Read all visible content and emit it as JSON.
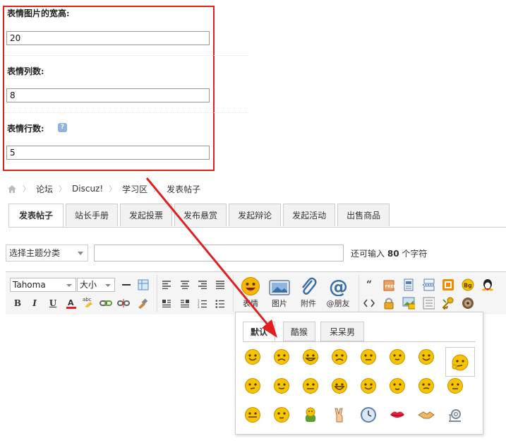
{
  "settings": {
    "width_label": "表情图片的宽高:",
    "width_value": "20",
    "cols_label": "表情列数:",
    "cols_value": "8",
    "rows_label": "表情行数:",
    "rows_value": "5",
    "highlight_color": "#e02020"
  },
  "breadcrumb": [
    "论坛",
    "Discuz!",
    "学习区",
    "发表帖子"
  ],
  "tabs": [
    "发表帖子",
    "站长手册",
    "发起投票",
    "发布悬赏",
    "发起辩论",
    "发起活动",
    "出售商品"
  ],
  "active_tab": "发表帖子",
  "subject": {
    "category_select": "选择主题分类",
    "char_hint_prefix": "还可输入",
    "char_count": "80",
    "char_hint_suffix": "个字符"
  },
  "editor": {
    "font_family": "Tahoma",
    "font_size": "大小",
    "format_buttons": [
      "B",
      "I",
      "U"
    ],
    "big_buttons": [
      "表情",
      "图片",
      "附件",
      "@朋友"
    ]
  },
  "emoji_popup": {
    "tabs": [
      "默认",
      "酷猴",
      "呆呆男"
    ],
    "active_tab": "默认",
    "columns": 8,
    "rows_visible": 3
  },
  "icons": [
    "home-icon",
    "help-icon",
    "smiley-icon",
    "image-icon",
    "attachment-icon",
    "at-icon",
    "quote-icon",
    "code-icon",
    "free-icon",
    "lock-icon"
  ]
}
